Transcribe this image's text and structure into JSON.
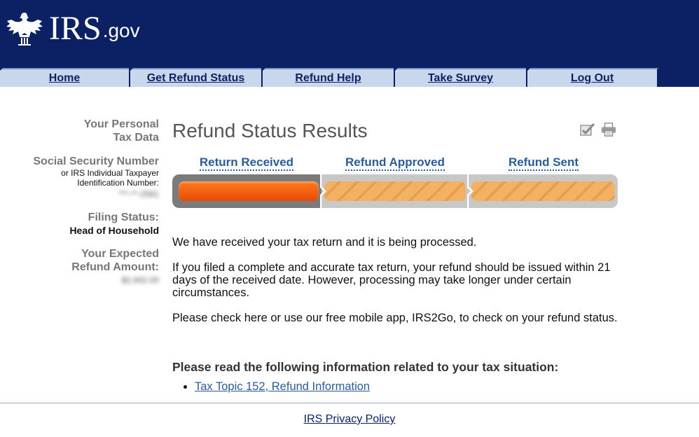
{
  "brand": {
    "logo_main": "IRS",
    "logo_suffix": ".gov"
  },
  "nav": {
    "tabs": [
      {
        "label": "Home"
      },
      {
        "label": "Get Refund Status"
      },
      {
        "label": "Refund Help"
      },
      {
        "label": "Take Survey"
      },
      {
        "label": "Log Out"
      }
    ]
  },
  "sidebar": {
    "personal_title_line1": "Your Personal",
    "personal_title_line2": "Tax Data",
    "ssn_label": "Social Security Number",
    "ssn_sub1": "or IRS Individual Taxpayer",
    "ssn_sub2": "Identification Number:",
    "ssn_value": "***-**-2581",
    "filing_label": "Filing Status:",
    "filing_value": "Head of Household",
    "refund_label1": "Your Expected",
    "refund_label2": "Refund Amount:",
    "refund_value": "$2,942.00"
  },
  "main": {
    "title": "Refund Status Results",
    "tools": [
      "checkmark-icon",
      "print-icon"
    ],
    "steps": [
      {
        "label": "Return Received"
      },
      {
        "label": "Refund Approved"
      },
      {
        "label": "Refund Sent"
      }
    ],
    "progress_completed_steps": 1,
    "paragraph1": "We have received your tax return and it is being processed.",
    "paragraph2": "If you filed a complete and accurate tax return, your refund should be issued within 21 days of the received date. However, processing may take longer under certain circumstances.",
    "paragraph3": "Please check here or use our free mobile app, IRS2Go, to check on your refund status.",
    "info_heading": "Please read the following information related to your tax situation:",
    "info_links": [
      {
        "label": "Tax Topic 152, Refund Information"
      }
    ]
  },
  "footer": {
    "privacy_link": "IRS Privacy Policy"
  },
  "colors": {
    "header": "#0b2164",
    "tab": "#c9d7ec",
    "accent_orange": "#e84a05",
    "link": "#2a5b9a"
  }
}
